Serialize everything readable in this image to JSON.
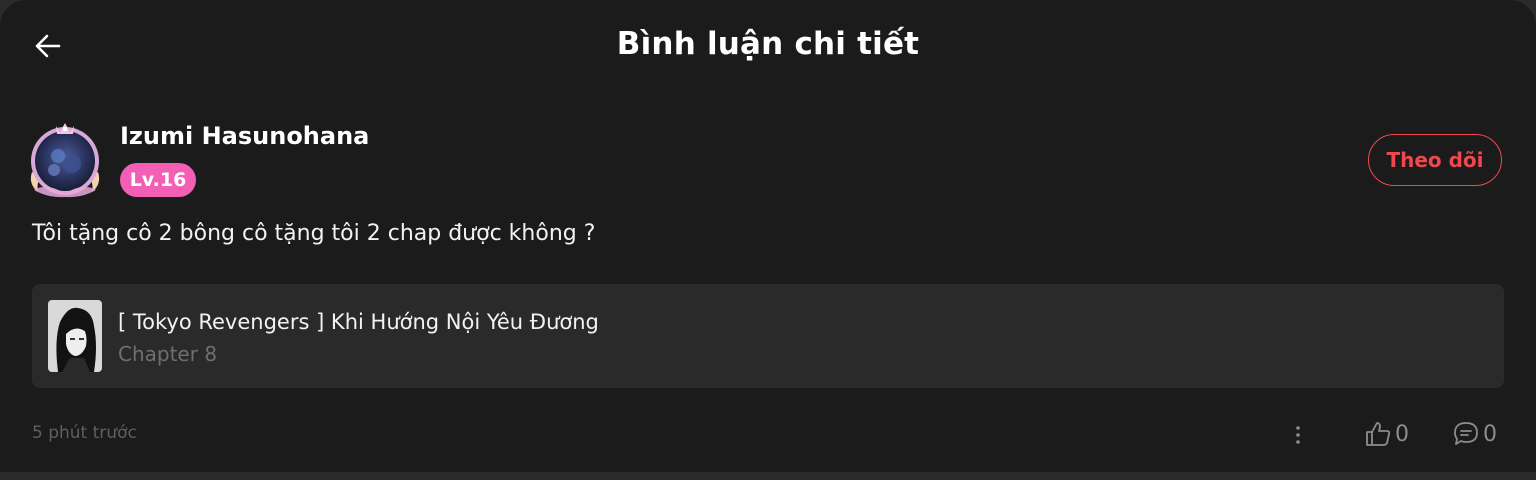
{
  "header": {
    "back_icon": "arrow-left-icon",
    "title": "Bình luận chi tiết"
  },
  "comment": {
    "user": {
      "name": "Izumi Hasunohana",
      "level": "Lv.16",
      "level_color": "#f35fb4",
      "follow_label": "Theo dõi",
      "follow_color": "#f0474f"
    },
    "text": "Tôi tặng cô 2 bông cô tặng tôi 2 chap được không ?",
    "story": {
      "title": "[ Tokyo Revengers ] Khi Hướng Nội Yêu Đương",
      "chapter": "Chapter 8"
    },
    "timestamp": "5 phút trước",
    "likes": "0",
    "replies": "0",
    "icons": {
      "more": "more-vertical-icon",
      "like": "thumbs-up-icon",
      "reply": "comment-icon"
    }
  },
  "colors": {
    "background": "#1b1b1b",
    "card": "#2a2a2a",
    "muted_text": "#6f6f6f"
  }
}
